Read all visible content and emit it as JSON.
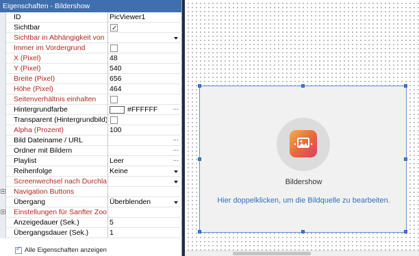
{
  "panel": {
    "title": "Eigenschaften - Bildershow",
    "show_all_label": "Alle Eigenschaften anzeigen"
  },
  "properties": [
    {
      "name": "ID",
      "value": "PicViewer1",
      "control": "text",
      "highlight": false
    },
    {
      "name": "Sichtbar",
      "value": "",
      "control": "checkbox",
      "checked": true,
      "highlight": false
    },
    {
      "name": "Sichtbar in Abhängigkeit von",
      "value": "",
      "control": "dropdown",
      "highlight": true
    },
    {
      "name": "Immer im Vordergrund",
      "value": "",
      "control": "checkbox",
      "checked": false,
      "highlight": true
    },
    {
      "name": "X (Pixel)",
      "value": "48",
      "control": "text",
      "highlight": true
    },
    {
      "name": "Y (Pixel)",
      "value": "540",
      "control": "text",
      "highlight": true
    },
    {
      "name": "Breite (Pixel)",
      "value": "656",
      "control": "text",
      "highlight": true
    },
    {
      "name": "Höhe (Pixel)",
      "value": "464",
      "control": "text",
      "highlight": true
    },
    {
      "name": "Seitenverhältnis einhalten",
      "value": "",
      "control": "checkbox",
      "checked": false,
      "highlight": true
    },
    {
      "name": "Hintergrundfarbe",
      "value": "#FFFFFF",
      "control": "color",
      "highlight": false
    },
    {
      "name": "Transparent (Hintergrundbild)",
      "value": "",
      "control": "checkbox",
      "checked": false,
      "highlight": false
    },
    {
      "name": "Alpha (Prozent)",
      "value": "100",
      "control": "text",
      "highlight": true
    },
    {
      "name": "Bild Dateiname / URL",
      "value": "",
      "control": "ellipsis",
      "highlight": false
    },
    {
      "name": "Ordner mit Bildern",
      "value": "",
      "control": "ellipsis",
      "highlight": false
    },
    {
      "name": "Playlist",
      "value": "Leer",
      "control": "ellipsis",
      "highlight": false
    },
    {
      "name": "Reihenfolge",
      "value": "Keine",
      "control": "dropdown",
      "highlight": false
    },
    {
      "name": "Screenwechsel nach Durchlauf",
      "value": "",
      "control": "dropdown",
      "highlight": true
    },
    {
      "name": "Navigation Buttons",
      "value": "",
      "control": "group",
      "highlight": true
    },
    {
      "name": "Übergang",
      "value": "Überblenden",
      "control": "dropdown",
      "highlight": false
    },
    {
      "name": "Einstellungen für Sanfter Zoom",
      "value": "",
      "control": "group",
      "highlight": true
    },
    {
      "name": "Anzeigedauer (Sek.)",
      "value": "5",
      "control": "text",
      "highlight": false
    },
    {
      "name": "Übergangsdauer (Sek.)",
      "value": "1",
      "control": "text",
      "highlight": false
    }
  ],
  "canvas": {
    "widget_label": "Bildershow",
    "widget_hint": "Hier doppelklicken, um die Bildquelle zu bearbeiten."
  },
  "icons": {
    "slideshow": "slideshow-icon",
    "ellipsis": "ellipsis-icon",
    "dropdown": "chevron-down-icon",
    "expand": "plus-icon"
  },
  "colors": {
    "title_bar": "#3f6fae",
    "highlight_text": "#b3261e",
    "hint_text": "#2f6fbe",
    "selection": "#3f7fd8",
    "icon_gradient_start": "#f2b04a",
    "icon_gradient_end": "#de3b62"
  }
}
